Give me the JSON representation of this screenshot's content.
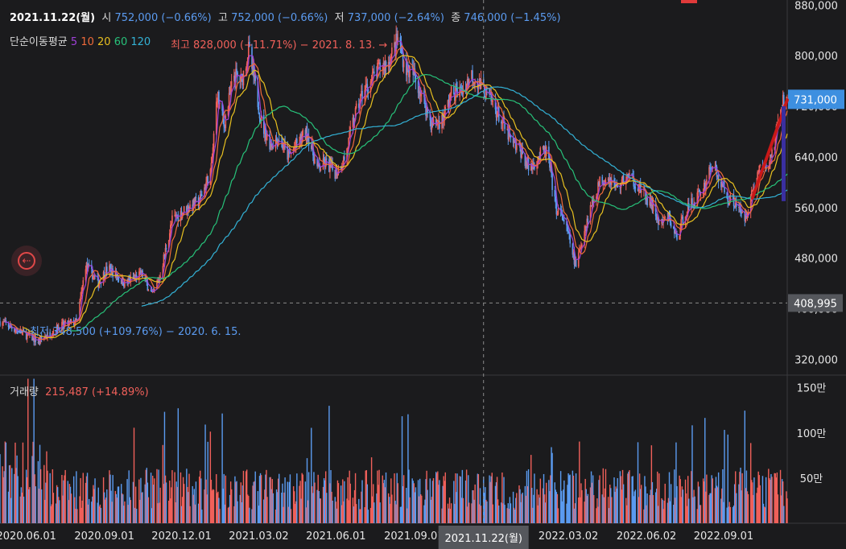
{
  "header": {
    "date": "2021.11.22(월)",
    "open_label": "시",
    "open_value": "752,000 (−0.66%)",
    "high_label": "고",
    "high_value": "752,000 (−0.66%)",
    "low_label": "저",
    "low_value": "737,000 (−2.64%)",
    "close_label": "종",
    "close_value": "746,000 (−1.45%)"
  },
  "moving_average": {
    "label": "단순이동평균",
    "periods": [
      "5",
      "10",
      "20",
      "60",
      "120"
    ],
    "colors": [
      "#a040d8",
      "#f06a3a",
      "#e8c020",
      "#27c27a",
      "#33b2d6"
    ]
  },
  "annotations": {
    "high": "최고 828,000 (−11.71%) − 2021. 8. 13. →",
    "low": "← 최저 348,500 (+109.76%) − 2020. 6. 15."
  },
  "volume_header": {
    "label": "거래량",
    "value": "215,487 (+14.89%)"
  },
  "crosshair": {
    "date_label": "2021.11.22(월)",
    "price_label": "408,995"
  },
  "chart_data": {
    "type": "candlestick",
    "price_axis": {
      "ticks": [
        {
          "value": 320000,
          "label": "320,000"
        },
        {
          "value": 400000,
          "label": "400,000"
        },
        {
          "value": 480000,
          "label": "480,000"
        },
        {
          "value": 560000,
          "label": "560,000"
        },
        {
          "value": 640000,
          "label": "640,000"
        },
        {
          "value": 720000,
          "label": "720,000"
        },
        {
          "value": 800000,
          "label": "800,000"
        },
        {
          "value": 880000,
          "label": "880,000"
        }
      ],
      "range": [
        295000,
        888000
      ]
    },
    "current_price": {
      "value": 731000,
      "label": "731,000"
    },
    "volume_axis": {
      "ticks": [
        {
          "value": 500000,
          "label": "50만"
        },
        {
          "value": 1000000,
          "label": "100만"
        },
        {
          "value": 1500000,
          "label": "150만"
        }
      ],
      "range": [
        0,
        1640000
      ]
    },
    "time_axis": {
      "start": "2020.05.01",
      "end": "2022.11.15",
      "ticks": [
        {
          "date": "2020.06.01",
          "label": "2020.06.01"
        },
        {
          "date": "2020.09.01",
          "label": "2020.09.01"
        },
        {
          "date": "2020.12.01",
          "label": "2020.12.01"
        },
        {
          "date": "2021.03.02",
          "label": "2021.03.02"
        },
        {
          "date": "2021.06.01",
          "label": "2021.06.01"
        },
        {
          "date": "2021.09.01",
          "label": "2021.09.01"
        },
        {
          "date": "2022.03.02",
          "label": "2022.03.02"
        },
        {
          "date": "2022.06.02",
          "label": "2022.06.02"
        },
        {
          "date": "2022.09.01",
          "label": "2022.09.01"
        }
      ]
    },
    "price_path": [
      [
        "2020.05.01",
        380000
      ],
      [
        "2020.06.15",
        348500
      ],
      [
        "2020.07.10",
        372000
      ],
      [
        "2020.07.31",
        380000
      ],
      [
        "2020.08.10",
        470000
      ],
      [
        "2020.08.25",
        440000
      ],
      [
        "2020.09.05",
        465000
      ],
      [
        "2020.09.25",
        440000
      ],
      [
        "2020.10.15",
        455000
      ],
      [
        "2020.10.28",
        420000
      ],
      [
        "2020.11.05",
        450000
      ],
      [
        "2020.11.20",
        540000
      ],
      [
        "2020.12.08",
        560000
      ],
      [
        "2020.12.22",
        570000
      ],
      [
        "2021.01.05",
        620000
      ],
      [
        "2021.01.12",
        740000
      ],
      [
        "2021.01.20",
        690000
      ],
      [
        "2021.02.01",
        770000
      ],
      [
        "2021.02.10",
        760000
      ],
      [
        "2021.02.18",
        810000
      ],
      [
        "2021.02.26",
        750000
      ],
      [
        "2021.03.06",
        690000
      ],
      [
        "2021.03.16",
        660000
      ],
      [
        "2021.03.26",
        670000
      ],
      [
        "2021.04.06",
        640000
      ],
      [
        "2021.04.16",
        660000
      ],
      [
        "2021.04.28",
        680000
      ],
      [
        "2021.05.10",
        620000
      ],
      [
        "2021.05.20",
        630000
      ],
      [
        "2021.06.01",
        615000
      ],
      [
        "2021.06.12",
        640000
      ],
      [
        "2021.06.22",
        700000
      ],
      [
        "2021.07.02",
        740000
      ],
      [
        "2021.07.12",
        760000
      ],
      [
        "2021.07.22",
        780000
      ],
      [
        "2021.08.02",
        790000
      ],
      [
        "2021.08.13",
        828000
      ],
      [
        "2021.08.22",
        780000
      ],
      [
        "2021.09.01",
        770000
      ],
      [
        "2021.09.12",
        730000
      ],
      [
        "2021.09.22",
        690000
      ],
      [
        "2021.10.05",
        700000
      ],
      [
        "2021.10.15",
        740000
      ],
      [
        "2021.10.28",
        745000
      ],
      [
        "2021.11.08",
        770000
      ],
      [
        "2021.11.22",
        746000
      ],
      [
        "2021.12.05",
        720000
      ],
      [
        "2021.12.15",
        690000
      ],
      [
        "2021.12.26",
        660000
      ],
      [
        "2022.01.05",
        650000
      ],
      [
        "2022.01.15",
        620000
      ],
      [
        "2022.01.25",
        640000
      ],
      [
        "2022.02.05",
        650000
      ],
      [
        "2022.02.15",
        560000
      ],
      [
        "2022.02.25",
        540000
      ],
      [
        "2022.03.05",
        500000
      ],
      [
        "2022.03.11",
        465000
      ],
      [
        "2022.03.18",
        510000
      ],
      [
        "2022.03.28",
        560000
      ],
      [
        "2022.04.08",
        600000
      ],
      [
        "2022.04.18",
        610000
      ],
      [
        "2022.04.28",
        590000
      ],
      [
        "2022.05.10",
        610000
      ],
      [
        "2022.05.20",
        600000
      ],
      [
        "2022.05.30",
        580000
      ],
      [
        "2022.06.10",
        560000
      ],
      [
        "2022.06.18",
        530000
      ],
      [
        "2022.06.28",
        545000
      ],
      [
        "2022.07.08",
        510000
      ],
      [
        "2022.07.18",
        555000
      ],
      [
        "2022.07.28",
        570000
      ],
      [
        "2022.08.08",
        590000
      ],
      [
        "2022.08.18",
        630000
      ],
      [
        "2022.08.28",
        600000
      ],
      [
        "2022.09.05",
        575000
      ],
      [
        "2022.09.15",
        570000
      ],
      [
        "2022.09.25",
        540000
      ],
      [
        "2022.10.05",
        585000
      ],
      [
        "2022.10.15",
        630000
      ],
      [
        "2022.10.22",
        620000
      ],
      [
        "2022.10.29",
        650000
      ],
      [
        "2022.11.05",
        700000
      ],
      [
        "2022.11.10",
        725000
      ],
      [
        "2022.11.15",
        731000
      ]
    ],
    "ma_smoothing_days": [
      5,
      10,
      20,
      60,
      120
    ],
    "trend_arrow": {
      "from": [
        "2022.10.05",
        575000
      ],
      "to": [
        "2022.11.15",
        730000
      ],
      "color": "#c81818"
    },
    "up_color": "#f0605a",
    "down_color": "#5b9bf0",
    "grid": false
  }
}
